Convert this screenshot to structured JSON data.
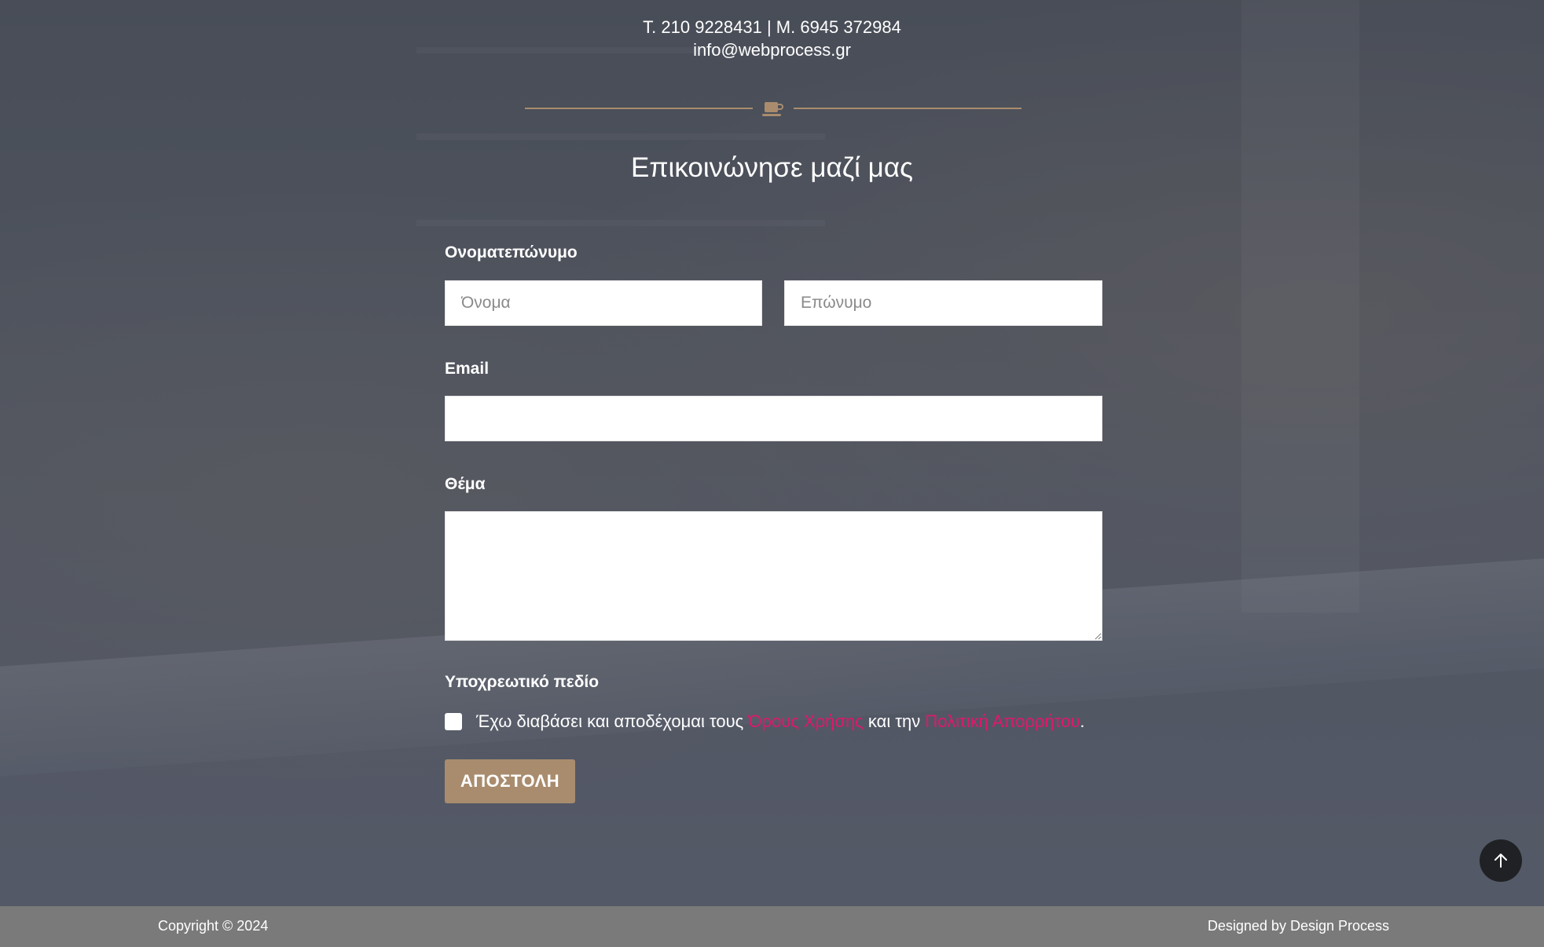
{
  "contact": {
    "phones": "T. 210 9228431 | M. 6945 372984",
    "email": "info@webprocess.gr"
  },
  "divider": {
    "icon": "coffee-cup-icon",
    "color": "#a98c6e"
  },
  "form": {
    "title": "Επικοινώνησε μαζί μας",
    "name_label": "Ονοματεπώνυμο",
    "first_name_placeholder": "Όνομα",
    "last_name_placeholder": "Επώνυμο",
    "email_label": "Email",
    "subject_label": "Θέμα",
    "required_label": "Υποχρεωτικό πεδίο",
    "consent": {
      "prefix": "Έχω διαβάσει και αποδέχομαι τους",
      "terms_link": "Όρους Χρήσης",
      "middle": "και την",
      "privacy_link": "Πολιτική Απορρήτου",
      "suffix": "."
    },
    "submit_label": "ΑΠΟΣΤΟΛΗ"
  },
  "back_to_top": {
    "icon": "arrow-up-icon"
  },
  "footer": {
    "copyright": "Copyright © 2024",
    "designed_by": "Designed by Design Process"
  },
  "colors": {
    "accent": "#a98c6e",
    "link": "#e0186c",
    "footer_bg": "#7a7a7a"
  }
}
